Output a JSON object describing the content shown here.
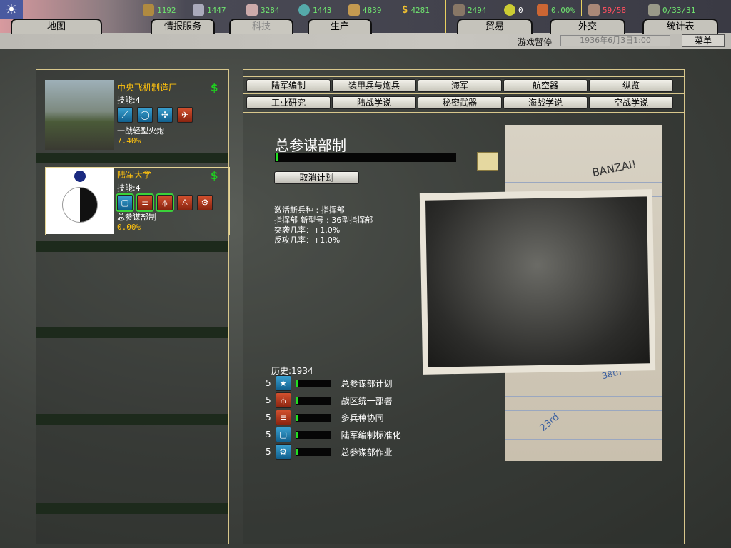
{
  "resources": [
    {
      "icon": "energy-icon",
      "value": "1192"
    },
    {
      "icon": "metal-icon",
      "value": "1447"
    },
    {
      "icon": "rare-materials-icon",
      "value": "3284"
    },
    {
      "icon": "oil-icon",
      "value": "1443"
    },
    {
      "icon": "supplies-icon",
      "value": "4839"
    },
    {
      "icon": "money-icon",
      "value": "4281"
    }
  ],
  "stats": {
    "manpower": "2494",
    "nuclear": "0",
    "dissent": "0.00%",
    "convoys": "59/58",
    "divisions": "0/33/31"
  },
  "tabs": [
    "地图",
    "情报服务",
    "科技",
    "生产",
    "贸易",
    "外交",
    "统计表"
  ],
  "status": {
    "paused": "游戏暂停",
    "date": "1936年6月3日1:00",
    "menu": "菜单"
  },
  "teams": [
    {
      "name": "中央飞机制造厂",
      "skill": "技能:4",
      "project": "一战轻型火炮",
      "progress": "7.40%",
      "dollar": "$"
    },
    {
      "name": "陆军大学",
      "skill": "技能:4",
      "project": "总参谋部制",
      "progress": "0.00%",
      "dollar": "$"
    }
  ],
  "tech_tabs": [
    "陆军编制",
    "装甲兵与炮兵",
    "海军",
    "航空器",
    "纵览",
    "工业研究",
    "陆战学说",
    "秘密武器",
    "海战学说",
    "空战学说"
  ],
  "project": {
    "title": "总参谋部制",
    "progress_fraction": 0.0,
    "cancel": "取消计划",
    "effects": [
      "激活新兵种 : 指挥部",
      "指挥部  新型号 : 36型指挥部",
      "突袭几率：+1.0%",
      "反攻几率：+1.0%"
    ],
    "history": "历史:1934",
    "components": [
      {
        "level": "5",
        "name": "总参谋部计划",
        "icon": "star-icon",
        "color": "blue"
      },
      {
        "level": "5",
        "name": "战区统一部署",
        "icon": "command-structure-icon",
        "color": "red"
      },
      {
        "level": "5",
        "name": "多兵种协同",
        "icon": "combined-arms-icon",
        "color": "red"
      },
      {
        "level": "5",
        "name": "陆军编制标准化",
        "icon": "manual-icon",
        "color": "blue"
      },
      {
        "level": "5",
        "name": "总参谋部作业",
        "icon": "gears-icon",
        "color": "blue"
      }
    ]
  },
  "notes": {
    "banzai": "BANZAI!",
    "a": "23rd",
    "b": "38th"
  }
}
